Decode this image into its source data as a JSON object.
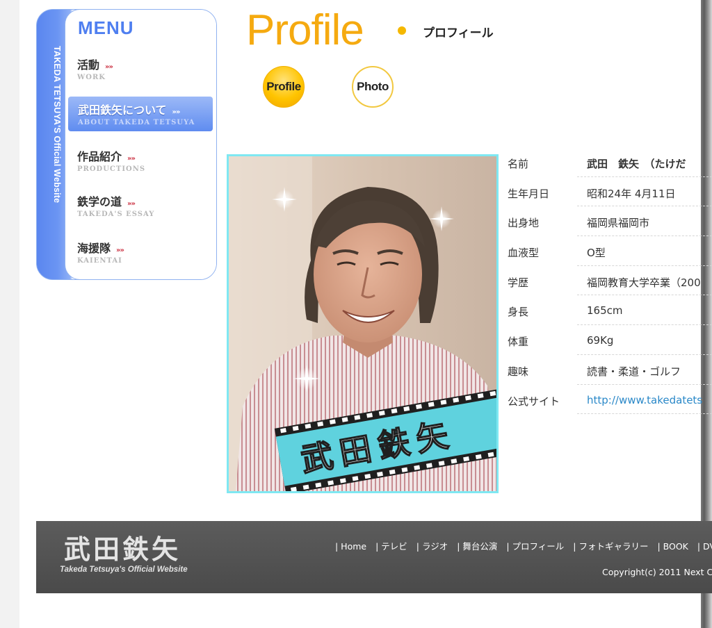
{
  "menu": {
    "vertical_label": "TAKEDA TETSUYA'S Official Website",
    "title": "MENU",
    "items": [
      {
        "jp": "活動",
        "arrows": "»»",
        "en": "WORK"
      },
      {
        "jp": "武田鉄矢について",
        "arrows": "»»",
        "en": "ABOUT TAKEDA TETSUYA"
      },
      {
        "jp": "作品紹介",
        "arrows": "»»",
        "en": "PRODUCTIONS"
      },
      {
        "jp": "鉄学の道",
        "arrows": "»»",
        "en": "TAKEDA'S ESSAY"
      },
      {
        "jp": "海援隊",
        "arrows": "»»",
        "en": "KAIENTAI"
      }
    ]
  },
  "header": {
    "title": "Profile",
    "subtitle": "プロフィール"
  },
  "tabs": {
    "profile": "Profile",
    "photo": "Photo"
  },
  "photo": {
    "banner_text": "武田鉄矢"
  },
  "profile_table": [
    {
      "label": "名前",
      "value": "武田　鉄矢　（たけだ"
    },
    {
      "label": "生年月日",
      "value": "昭和24年 4月11日"
    },
    {
      "label": "出身地",
      "value": "福岡県福岡市"
    },
    {
      "label": "血液型",
      "value": "O型"
    },
    {
      "label": "学歴",
      "value": "福岡教育大学卒業（200"
    },
    {
      "label": "身長",
      "value": "165cm"
    },
    {
      "label": "体重",
      "value": "69Kg"
    },
    {
      "label": "趣味",
      "value": "読書・柔道・ゴルフ"
    },
    {
      "label": "公式サイト",
      "value": "http://www.takedatets"
    }
  ],
  "footer": {
    "logo": "武田鉄矢",
    "tagline": "Takeda Tetsuya's Official Website",
    "nav": [
      "| Home",
      "| テレビ",
      "| ラジオ",
      "| 舞台公演",
      "| プロフィール",
      "| フォトギャラリー",
      "| BOOK",
      "| DVD"
    ],
    "copyright": "Copyright(c) 2011 Next C"
  },
  "colors": {
    "menu_blue": "#5f8cf0",
    "profile_orange": "#f5aa10",
    "frame_cyan": "#7fe8f2",
    "link_blue": "#2a88c8"
  }
}
